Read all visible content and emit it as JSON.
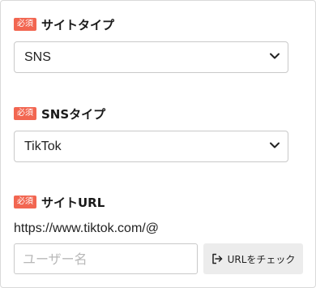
{
  "site_type": {
    "badge": "必須",
    "label": "サイトタイプ",
    "value": "SNS"
  },
  "sns_type": {
    "badge": "必須",
    "label": "SNSタイプ",
    "value": "TikTok"
  },
  "site_url": {
    "badge": "必須",
    "label": "サイトURL",
    "prefix": "https://www.tiktok.com/@",
    "username_placeholder": "ユーザー名",
    "username_value": "",
    "check_button_label": "URLをチェック",
    "check_button_icon": "sign-out-icon"
  },
  "colors": {
    "badge_bg": "#f26651",
    "button_bg": "#ececec",
    "border": "#c9c9c9"
  }
}
